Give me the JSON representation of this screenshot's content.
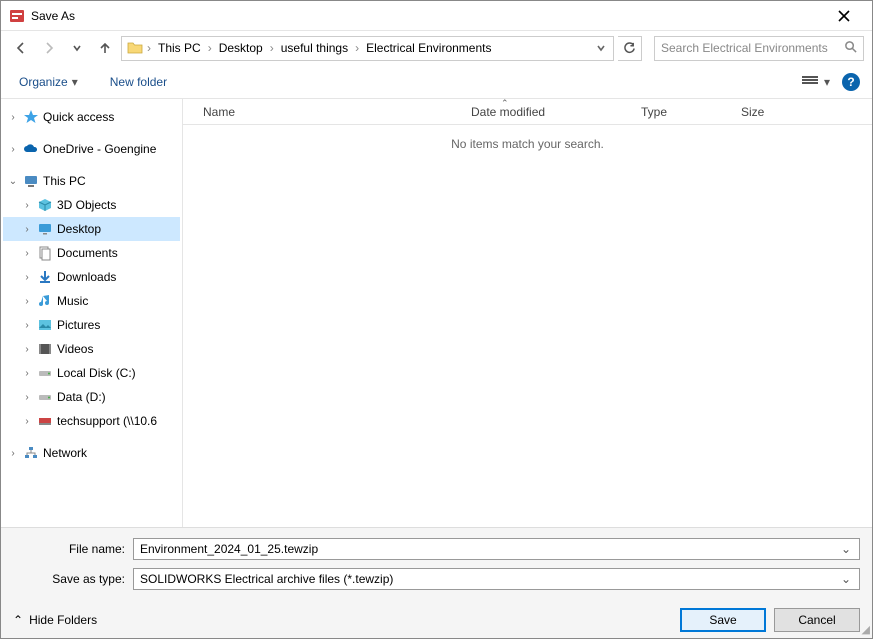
{
  "title": "Save As",
  "breadcrumb": [
    "This PC",
    "Desktop",
    "useful things",
    "Electrical Environments"
  ],
  "search_placeholder": "Search Electrical Environments",
  "toolbar": {
    "organize": "Organize",
    "new_folder": "New folder"
  },
  "columns": {
    "name": "Name",
    "date": "Date modified",
    "type": "Type",
    "size": "Size"
  },
  "empty_msg": "No items match your search.",
  "tree": {
    "quick_access": "Quick access",
    "onedrive": "OneDrive - Goengine",
    "this_pc": "This PC",
    "children": {
      "objects3d": "3D Objects",
      "desktop": "Desktop",
      "documents": "Documents",
      "downloads": "Downloads",
      "music": "Music",
      "pictures": "Pictures",
      "videos": "Videos",
      "localc": "Local Disk (C:)",
      "datad": "Data (D:)",
      "tech": "techsupport (\\\\10.6"
    },
    "network": "Network"
  },
  "form": {
    "filename_label": "File name:",
    "filename_value": "Environment_2024_01_25.tewzip",
    "type_label": "Save as type:",
    "type_value": "SOLIDWORKS Electrical archive files (*.tewzip)"
  },
  "buttons": {
    "hide_folders": "Hide Folders",
    "save": "Save",
    "cancel": "Cancel"
  }
}
